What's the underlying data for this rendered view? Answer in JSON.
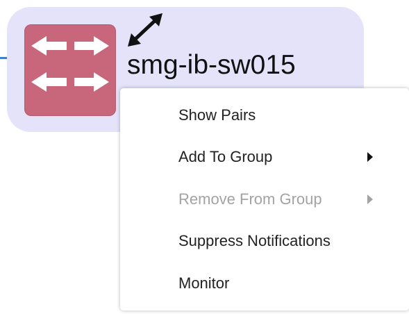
{
  "node": {
    "label": "smg-ib-sw015",
    "icon": "network-switch-icon",
    "expand_icon": "expand-arrows-icon",
    "card_color": "#e4e3fa",
    "icon_color": "#c8677b",
    "link_color": "#3f7fd0"
  },
  "context_menu": {
    "items": [
      {
        "label": "Show Pairs",
        "has_submenu": false,
        "enabled": true
      },
      {
        "label": "Add To Group",
        "has_submenu": true,
        "enabled": true
      },
      {
        "label": "Remove From Group",
        "has_submenu": true,
        "enabled": false
      },
      {
        "label": "Suppress Notifications",
        "has_submenu": false,
        "enabled": true
      },
      {
        "label": "Monitor",
        "has_submenu": false,
        "enabled": true
      }
    ]
  }
}
